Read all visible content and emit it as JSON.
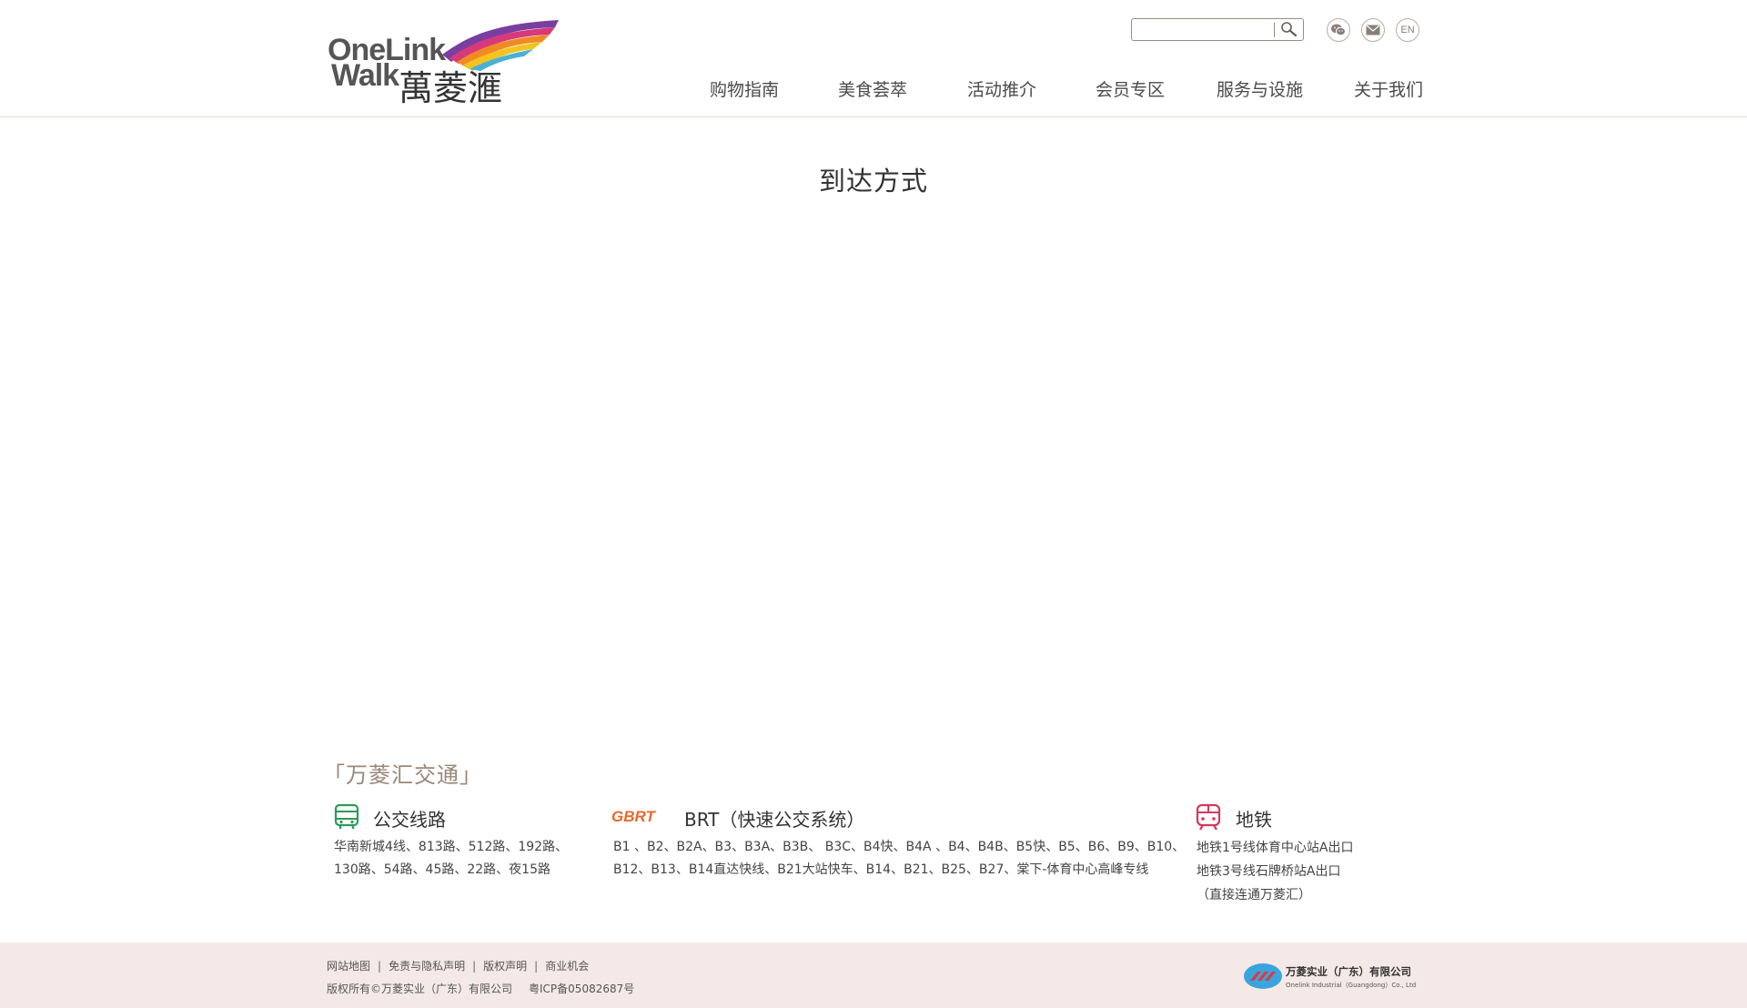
{
  "header": {
    "logo": {
      "line1": "OneLink",
      "line2": "Walk",
      "cn": "萬菱滙"
    },
    "search": {
      "placeholder": "",
      "value": ""
    },
    "icons": [
      "wechat-icon",
      "mail-icon",
      "search-icon"
    ],
    "lang_label": "EN",
    "nav": [
      "购物指南",
      "美食荟萃",
      "活动推介",
      "会员专区",
      "服务与设施",
      "关于我们"
    ]
  },
  "main": {
    "title": "到达方式",
    "transport_heading": "「万菱汇交通」",
    "bus": {
      "title": "公交线路",
      "lines": [
        "华南新城4线、813路、512路、192路、",
        "130路、54路、45路、22路、夜15路"
      ]
    },
    "brt": {
      "logo_text": "GBRT",
      "title": "BRT（快速公交系统）",
      "lines": [
        "B1 、B2、B2A、B3、B3A、B3B、 B3C、B4快、B4A 、B4、B4B、B5快、B5、B6、B9、B10、",
        "B12、B13、B14直达快线、B21大站快车、B14、B21、B25、B27、棠下-体育中心高峰专线"
      ]
    },
    "metro": {
      "title": "地铁",
      "lines": [
        "地铁1号线体育中心站A出口",
        "地铁3号线石牌桥站A出口",
        "（直接连通万菱汇）"
      ]
    }
  },
  "footer": {
    "links": [
      "网站地图",
      "免责与隐私声明",
      "版权声明",
      "商业机会"
    ],
    "copyright": "版权所有©万菱实业（广东）有限公司",
    "icp": "粤ICP备05082687号",
    "company_cn": "万菱实业（广东）有限公司",
    "company_en": "Onelink Industrial（Guangdong）Co., Ltd"
  },
  "colors": {
    "accent_brown": "#9b8778",
    "bus_green": "#2e9a5a",
    "brt_orange": "#e8692a",
    "metro_red": "#d6385a",
    "footer_bg": "#f4e9e7"
  }
}
